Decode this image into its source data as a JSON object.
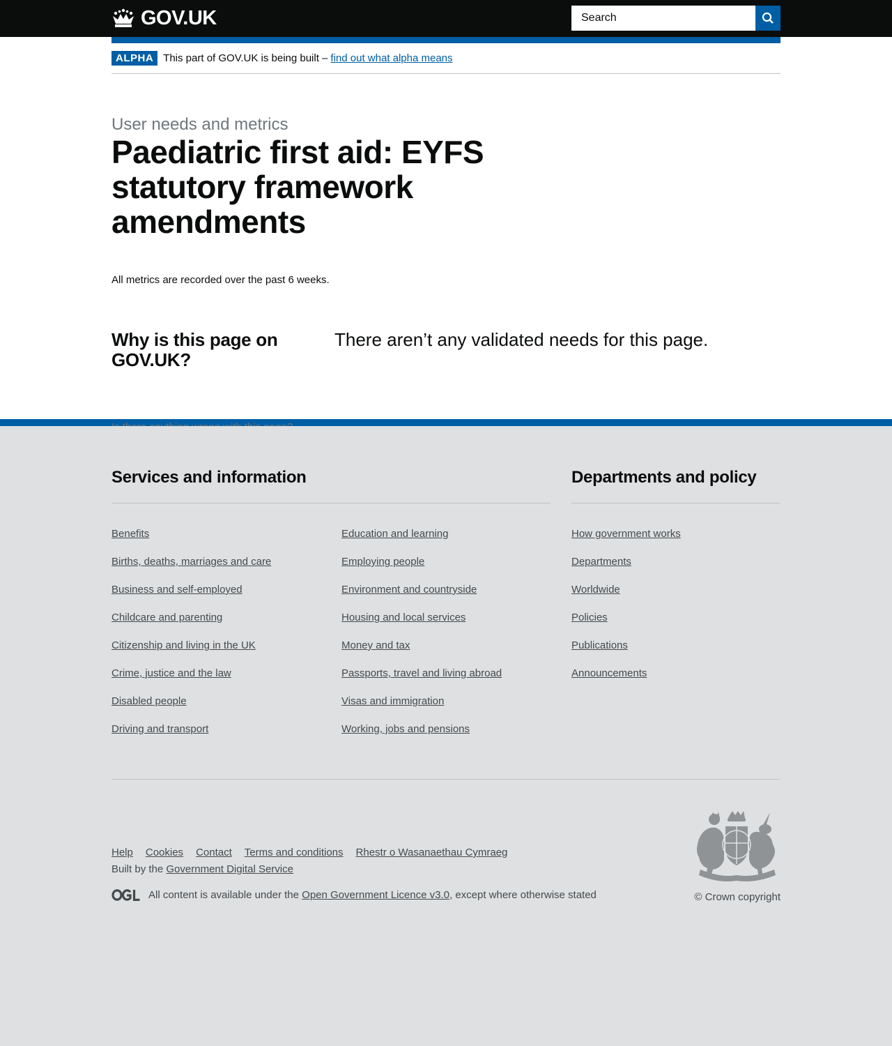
{
  "header": {
    "logo_text": "GOV.UK",
    "search_placeholder": "Search"
  },
  "phase_banner": {
    "tag": "ALPHA",
    "text": "This part of GOV.UK is being built –",
    "link": "find out what alpha means"
  },
  "main": {
    "caption": "User needs and metrics",
    "title": "Paediatric first aid: EYFS statutory framework amendments",
    "intro": "All metrics are recorded over the past 6 weeks.",
    "why_heading": "Why is this page on GOV.UK?",
    "needs_text": "There aren’t any validated needs for this page.",
    "report_link": "Is there anything wrong with this page?"
  },
  "footer": {
    "services_heading": "Services and information",
    "services_col1": [
      "Benefits",
      "Births, deaths, marriages and care",
      "Business and self-employed",
      "Childcare and parenting",
      "Citizenship and living in the UK",
      "Crime, justice and the law",
      "Disabled people",
      "Driving and transport"
    ],
    "services_col2": [
      "Education and learning",
      "Employing people",
      "Environment and countryside",
      "Housing and local services",
      "Money and tax",
      "Passports, travel and living abroad",
      "Visas and immigration",
      "Working, jobs and pensions"
    ],
    "departments_heading": "Departments and policy",
    "departments": [
      "How government works",
      "Departments",
      "Worldwide",
      "Policies",
      "Publications",
      "Announcements"
    ],
    "meta_links": [
      "Help",
      "Cookies",
      "Contact",
      "Terms and conditions",
      "Rhestr o Wasanaethau Cymraeg"
    ],
    "built_by_prefix": "Built by the",
    "built_by_link": "Government Digital Service",
    "licence_prefix": "All content is available under the",
    "licence_link": "Open Government Licence v3.0",
    "licence_suffix": ", except where otherwise stated",
    "copyright": "© Crown copyright"
  },
  "colors": {
    "brand_blue": "#005ea5",
    "header_black": "#0b0c0c",
    "footer_grey": "#dee0e2"
  }
}
